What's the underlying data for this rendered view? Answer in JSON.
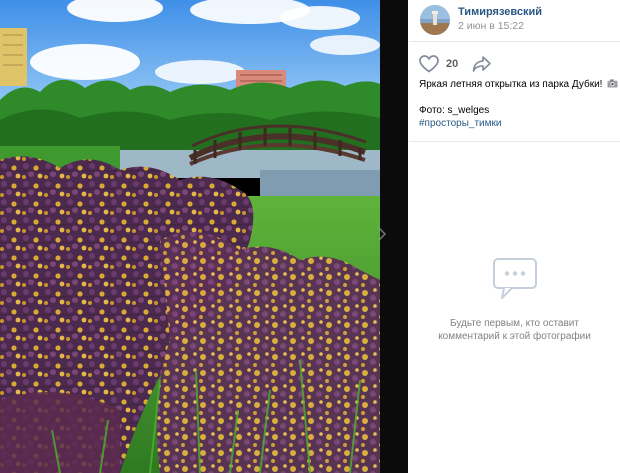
{
  "post": {
    "author": "Тимирязевский",
    "date": "2 июн в 15:22",
    "likes": "20",
    "caption": "Яркая летняя открытка из парка Дубки!",
    "caption_emoji": "camera-icon",
    "credit_prefix": "Фото: ",
    "credit_user": "s_welges",
    "hashtag": "#просторы_тимки"
  },
  "comments": {
    "empty_line1": "Будьте первым, кто оставит",
    "empty_line2": "комментарий к этой фотографии"
  },
  "icons": {
    "like": "heart-outline-icon",
    "share": "share-arrow-icon",
    "comments": "speech-bubble-icon",
    "next": "chevron-right-icon"
  },
  "colors": {
    "link": "#2a5885",
    "muted": "#939393",
    "icon": "#828a99",
    "empty_text": "#828282"
  }
}
